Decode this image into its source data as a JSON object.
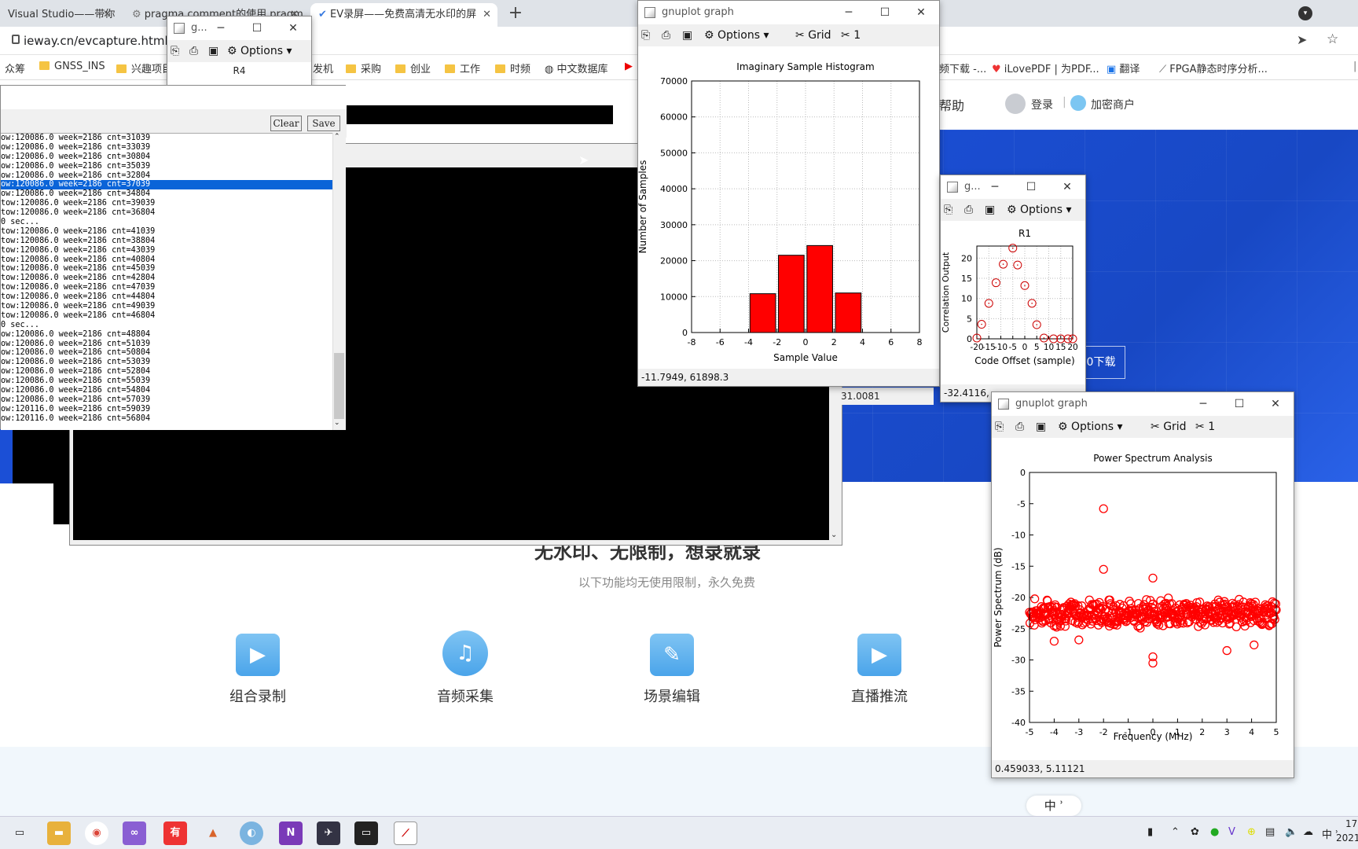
{
  "browser": {
    "tabs": [
      {
        "title": "Visual Studio——带你",
        "active": false
      },
      {
        "title": "pragma comment的使用 pragm",
        "active": false
      },
      {
        "title": "EV录屏——免费高清无水印的屏",
        "active": true
      }
    ],
    "new_tab": "+",
    "url": "ieway.cn/evcapture.html",
    "bookmarks": [
      "众筹",
      "GNSS_INS",
      "兴趣项目",
      "发机",
      "采购",
      "创业",
      "工作",
      "时频",
      "中文数据库",
      "频下载 -...",
      "iLovePDF | 为PDF...",
      "翻译",
      "FPGA静态时序分析..."
    ]
  },
  "page": {
    "nav_help": "帮助",
    "login": "登录",
    "merchant": "加密商户",
    "download_btn": "0下载",
    "slogan": "无水印、无限制，想录就录",
    "subtitle": "以下功能均无使用限制，永久免费",
    "features": [
      {
        "label": "组合录制",
        "icon": "video-camera-icon"
      },
      {
        "label": "音频采集",
        "icon": "music-note-icon"
      },
      {
        "label": "场景编辑",
        "icon": "edit-pen-icon"
      },
      {
        "label": "直播推流",
        "icon": "live-play-icon"
      }
    ],
    "ime_indicator": "中 ʾ"
  },
  "log_window": {
    "clear_label": "Clear",
    "save_label": "Save",
    "lines": [
      "ow:120086.0 week=2186 cnt=31039",
      "ow:120086.0 week=2186 cnt=33039",
      "ow:120086.0 week=2186 cnt=30804",
      "ow:120086.0 week=2186 cnt=35039",
      "ow:120086.0 week=2186 cnt=32804",
      "ow:120086.0 week=2186 cnt=37039",
      "ow:120086.0 week=2186 cnt=34804",
      "tow:120086.0 week=2186 cnt=39039",
      "tow:120086.0 week=2186 cnt=36804",
      "0 sec...",
      "tow:120086.0 week=2186 cnt=41039",
      "tow:120086.0 week=2186 cnt=38804",
      "tow:120086.0 week=2186 cnt=43039",
      "tow:120086.0 week=2186 cnt=40804",
      "tow:120086.0 week=2186 cnt=45039",
      "tow:120086.0 week=2186 cnt=42804",
      "tow:120086.0 week=2186 cnt=47039",
      "tow:120086.0 week=2186 cnt=44804",
      "tow:120086.0 week=2186 cnt=49039",
      "tow:120086.0 week=2186 cnt=46804",
      "0 sec...",
      "ow:120086.0 week=2186 cnt=48804",
      "ow:120086.0 week=2186 cnt=51039",
      "ow:120086.0 week=2186 cnt=50804",
      "ow:120086.0 week=2186 cnt=53039",
      "ow:120086.0 week=2186 cnt=52804",
      "ow:120086.0 week=2186 cnt=55039",
      "ow:120086.0 week=2186 cnt=54804",
      "ow:120086.0 week=2186 cnt=57039",
      "ow:120116.0 week=2186 cnt=59039",
      "ow:120116.0 week=2186 cnt=56804"
    ],
    "selected_index": 5
  },
  "gnuplot_small_r4": {
    "title": "g...",
    "options": "Options",
    "plot_title": "R4"
  },
  "gnuplot_hist": {
    "title": "gnuplot graph",
    "options": "Options",
    "grid": "Grid",
    "num": "1",
    "status": "-11.7949,  61898.3"
  },
  "gnuplot_r1": {
    "title": "g...",
    "options": "Options",
    "status": "-32.4116,"
  },
  "gnuplot_psd": {
    "title": "gnuplot graph",
    "options": "Options",
    "grid": "Grid",
    "num": "1",
    "status": "0.459033,  5.11121"
  },
  "behind_status_fragment": "31.0081",
  "taskbar": {
    "clock": "17",
    "year_frag": "2021",
    "lang": "中",
    "apps": [
      "windows-taskview-icon",
      "file-explorer-icon",
      "chrome-icon",
      "visual-studio-icon",
      "youdao-icon",
      "matlab-icon",
      "browser-globe-icon",
      "onenote-icon",
      "gnss-app-icon",
      "terminal-icon",
      "gnuplot-icon"
    ]
  },
  "chart_data": [
    {
      "type": "bar",
      "title": "Imaginary Sample Histogram",
      "xlabel": "Sample Value",
      "ylabel": "Number of Samples",
      "xlim": [
        -8,
        8
      ],
      "ylim": [
        0,
        70000
      ],
      "xticks": [
        -8,
        -6,
        -4,
        -2,
        0,
        2,
        4,
        6,
        8
      ],
      "yticks": [
        0,
        10000,
        20000,
        30000,
        40000,
        50000,
        60000,
        70000
      ],
      "x": [
        -3,
        -1,
        1,
        3
      ],
      "values": [
        10800,
        21500,
        24200,
        11000
      ],
      "color": "#ff0000",
      "grid": true
    },
    {
      "type": "scatter",
      "title": "R1",
      "xlabel": "Code Offset (sample)",
      "ylabel": "Correlation Output",
      "xlim": [
        -20,
        20
      ],
      "ylim": [
        0,
        23
      ],
      "xtick_labels": [
        "-20",
        "-15",
        "-10",
        "-5",
        "0",
        "5",
        "10",
        "15",
        "20"
      ],
      "yticks": [
        0,
        5,
        10,
        15,
        20
      ],
      "x": [
        -20,
        -18,
        -15,
        -12,
        -9,
        -5,
        -3,
        0,
        3,
        5,
        8,
        12,
        15,
        18,
        20
      ],
      "y": [
        0.2,
        3.6,
        8.8,
        13.9,
        18.5,
        22.5,
        18.3,
        13.2,
        8.8,
        3.5,
        0.2,
        0,
        0,
        0,
        0
      ],
      "marker": "circle",
      "color": "#cc0000"
    },
    {
      "type": "scatter",
      "title": "Power Spectrum Analysis",
      "xlabel": "Frequency (MHz)",
      "ylabel": "Power Spectrum (dB)",
      "xlim": [
        -5,
        5
      ],
      "ylim": [
        -40,
        0
      ],
      "xticks": [
        -5,
        -4,
        -3,
        -2,
        -1,
        0,
        1,
        2,
        3,
        4,
        5
      ],
      "yticks": [
        0,
        -5,
        -10,
        -15,
        -20,
        -25,
        -30,
        -35,
        -40
      ],
      "notable_points": [
        {
          "x": -2,
          "y": -5.8
        },
        {
          "x": -2,
          "y": -15.5
        },
        {
          "x": 0,
          "y": -16.9
        },
        {
          "x": 0,
          "y": -30.5
        },
        {
          "x": 0,
          "y": -29.5
        },
        {
          "x": -3,
          "y": -26.8
        },
        {
          "x": -4,
          "y": -27
        },
        {
          "x": 3,
          "y": -28.5
        },
        {
          "x": 4.1,
          "y": -27.6
        }
      ],
      "noise_band": {
        "x_from": -5,
        "x_to": 5,
        "y_center": -22.5,
        "y_spread": 2.5
      },
      "marker": "circle",
      "color": "#ff0000"
    }
  ]
}
